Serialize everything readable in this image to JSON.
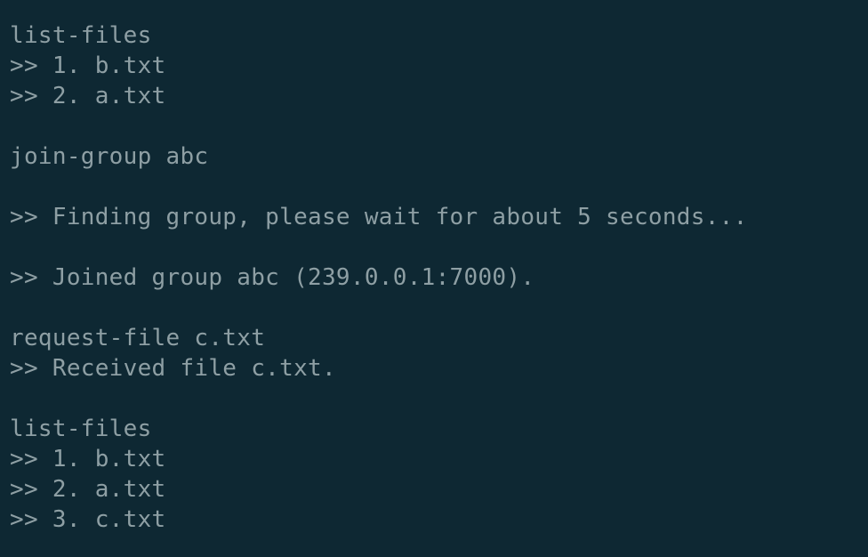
{
  "terminal": {
    "lines": [
      "list-files",
      ">> 1. b.txt",
      ">> 2. a.txt",
      "",
      "join-group abc",
      "",
      ">> Finding group, please wait for about 5 seconds...",
      "",
      ">> Joined group abc (239.0.0.1:7000).",
      "",
      "request-file c.txt",
      ">> Received file c.txt.",
      "",
      "list-files",
      ">> 1. b.txt",
      ">> 2. a.txt",
      ">> 3. c.txt"
    ],
    "colors": {
      "background": "#0e2833",
      "text": "#8e9fa4"
    }
  }
}
